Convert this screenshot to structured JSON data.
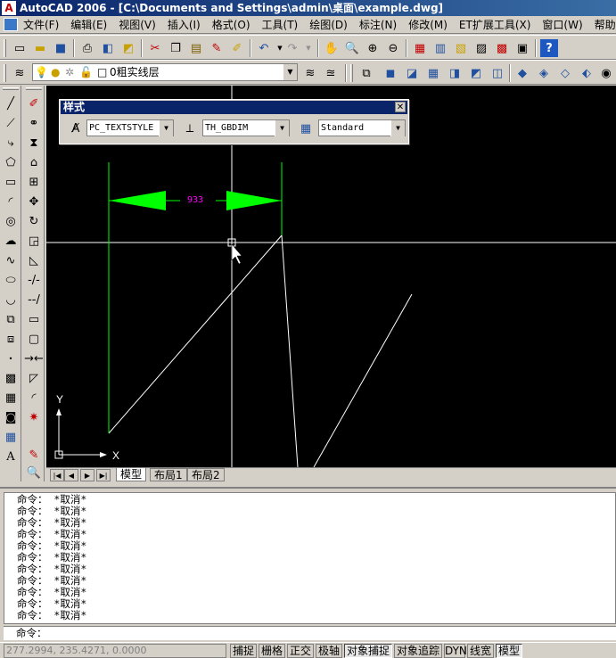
{
  "window": {
    "title": "AutoCAD 2006 - [C:\\Documents and Settings\\admin\\桌面\\example.dwg]"
  },
  "menu": [
    "文件(F)",
    "编辑(E)",
    "视图(V)",
    "插入(I)",
    "格式(O)",
    "工具(T)",
    "绘图(D)",
    "标注(N)",
    "修改(M)",
    "ET扩展工具(X)",
    "窗口(W)",
    "帮助(H)"
  ],
  "layers": {
    "current": "0粗实线层"
  },
  "style_panel": {
    "title": "样式",
    "text_style": "PC_TEXTSTYLE",
    "dim_style": "TH_GBDIM",
    "table_style": "Standard"
  },
  "drawing": {
    "dimension_text": "933",
    "ucs_x": "X",
    "ucs_y": "Y"
  },
  "layout_tabs": [
    "模型",
    "布局1",
    "布局2"
  ],
  "command": {
    "history": [
      "命令： *取消*",
      "命令： *取消*",
      "命令： *取消*",
      "命令： *取消*",
      "命令： *取消*",
      "命令： *取消*",
      "命令： *取消*",
      "命令： *取消*",
      "命令： *取消*",
      "命令： *取消*",
      "命令： *取消*",
      "命令： *取消*"
    ],
    "prompt": "命令："
  },
  "status": {
    "coordinates": "277.2994, 235.4271, 0.0000",
    "buttons": [
      {
        "label": "捕捉",
        "on": false
      },
      {
        "label": "栅格",
        "on": false
      },
      {
        "label": "正交",
        "on": false
      },
      {
        "label": "极轴",
        "on": false
      },
      {
        "label": "对象捕捉",
        "on": true
      },
      {
        "label": "对象追踪",
        "on": false
      },
      {
        "label": "DYN",
        "on": false
      },
      {
        "label": "线宽",
        "on": false
      },
      {
        "label": "模型",
        "on": true
      }
    ]
  },
  "colors": {
    "dimension": "#00ff00",
    "dimension_text": "#ff00ff",
    "title_bar": "#0a246a",
    "canvas": "#000000"
  }
}
